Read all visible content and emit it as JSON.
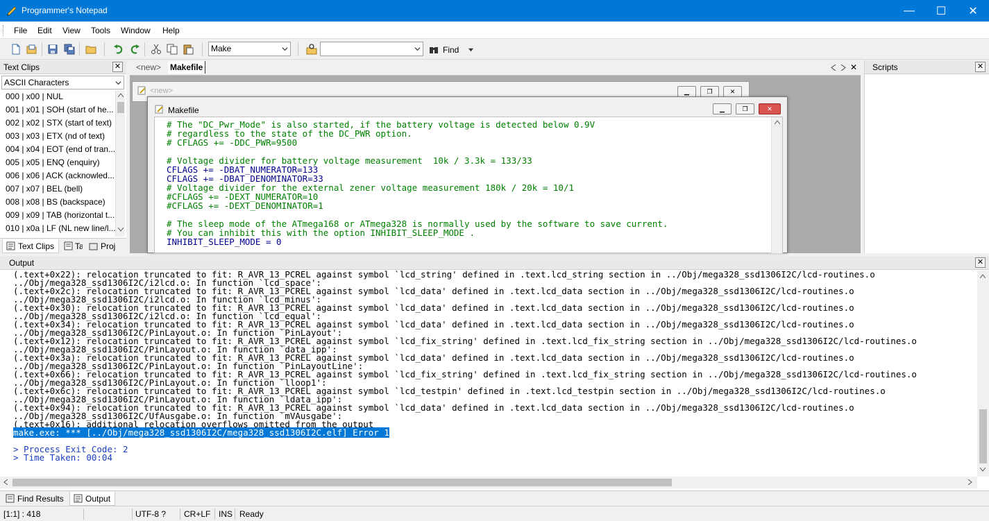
{
  "window": {
    "title": "Programmer's Notepad",
    "minimize": "—",
    "maximize": "☐",
    "close": "✕"
  },
  "menu": [
    "File",
    "Edit",
    "View",
    "Tools",
    "Window",
    "Help"
  ],
  "toolbar": {
    "scheme_value": "Make",
    "search_value": "",
    "find_label": "Find"
  },
  "clips_panel": {
    "title": "Text Clips",
    "category": "ASCII Characters",
    "items": [
      "000 | x00 | NUL",
      "001 | x01 | SOH (start of he...",
      "002 | x02 | STX (start of text)",
      "003 | x03 | ETX (nd of text)",
      "004 | x04 | EOT (end of tran...",
      "005 | x05 | ENQ (enquiry)",
      "006 | x06 | ACK (acknowled...",
      "007 | x07 | BEL (bell)",
      "008 | x08 | BS (backspace)",
      "009 | x09 | TAB (horizontal t...",
      "010 | x0a | LF (NL new line/l..."
    ],
    "tabs": [
      "Text Clips",
      "Ta",
      "Proj"
    ]
  },
  "doc_tabs": [
    "<new>",
    "Makefile"
  ],
  "child_new": {
    "title": "<new>"
  },
  "child_makefile": {
    "title": "Makefile"
  },
  "code_lines": [
    {
      "cls": "cmt",
      "text": "# The \"DC_Pwr_Mode\" is also started, if the battery voltage is detected below 0.9V"
    },
    {
      "cls": "cmt",
      "text": "# regardless to the state of the DC_PWR option."
    },
    {
      "cls": "cmt",
      "text": "# CFLAGS += -DDC_PWR=9500"
    },
    {
      "cls": "",
      "text": ""
    },
    {
      "cls": "cmt",
      "text": "# Voltage divider for battery voltage measurement  10k / 3.3k = 133/33"
    },
    {
      "cls": "kw",
      "text": "CFLAGS += -DBAT_NUMERATOR=133"
    },
    {
      "cls": "kw",
      "text": "CFLAGS += -DBAT_DENOMINATOR=33"
    },
    {
      "cls": "cmt",
      "text": "# Voltage divider for the external zener voltage measurement 180k / 20k = 10/1"
    },
    {
      "cls": "cmt",
      "text": "#CFLAGS += -DEXT_NUMERATOR=10"
    },
    {
      "cls": "cmt",
      "text": "#CFLAGS += -DEXT_DENOMINATOR=1"
    },
    {
      "cls": "",
      "text": ""
    },
    {
      "cls": "cmt",
      "text": "# The sleep mode of the ATmega168 or ATmega328 is normally used by the software to save current."
    },
    {
      "cls": "cmt",
      "text": "# You can inhibit this with the option INHIBIT_SLEEP_MODE ."
    },
    {
      "cls": "kw",
      "text": "INHIBIT_SLEEP_MODE = 0"
    }
  ],
  "scripts_panel": {
    "title": "Scripts"
  },
  "output_panel": {
    "title": "Output",
    "lines": [
      {
        "cls": "",
        "text": "(.text+0x22): relocation truncated to fit: R_AVR_13_PCREL against symbol `lcd_string' defined in .text.lcd_string section in ../Obj/mega328_ssd1306I2C/lcd-routines.o"
      },
      {
        "cls": "",
        "text": "../Obj/mega328_ssd1306I2C/i2lcd.o: In function `lcd_space':"
      },
      {
        "cls": "",
        "text": "(.text+0x2c): relocation truncated to fit: R_AVR_13_PCREL against symbol `lcd_data' defined in .text.lcd_data section in ../Obj/mega328_ssd1306I2C/lcd-routines.o"
      },
      {
        "cls": "",
        "text": "../Obj/mega328_ssd1306I2C/i2lcd.o: In function `lcd_minus':"
      },
      {
        "cls": "",
        "text": "(.text+0x30): relocation truncated to fit: R_AVR_13_PCREL against symbol `lcd_data' defined in .text.lcd_data section in ../Obj/mega328_ssd1306I2C/lcd-routines.o"
      },
      {
        "cls": "",
        "text": "../Obj/mega328_ssd1306I2C/i2lcd.o: In function `lcd_equal':"
      },
      {
        "cls": "",
        "text": "(.text+0x34): relocation truncated to fit: R_AVR_13_PCREL against symbol `lcd_data' defined in .text.lcd_data section in ../Obj/mega328_ssd1306I2C/lcd-routines.o"
      },
      {
        "cls": "",
        "text": "../Obj/mega328_ssd1306I2C/PinLayout.o: In function `PinLayout':"
      },
      {
        "cls": "",
        "text": "(.text+0x12): relocation truncated to fit: R_AVR_13_PCREL against symbol `lcd_fix_string' defined in .text.lcd_fix_string section in ../Obj/mega328_ssd1306I2C/lcd-routines.o"
      },
      {
        "cls": "",
        "text": "../Obj/mega328_ssd1306I2C/PinLayout.o: In function `data_ipp':"
      },
      {
        "cls": "",
        "text": "(.text+0x3a): relocation truncated to fit: R_AVR_13_PCREL against symbol `lcd_data' defined in .text.lcd_data section in ../Obj/mega328_ssd1306I2C/lcd-routines.o"
      },
      {
        "cls": "",
        "text": "../Obj/mega328_ssd1306I2C/PinLayout.o: In function `PinLayoutLine':"
      },
      {
        "cls": "",
        "text": "(.text+0x66): relocation truncated to fit: R_AVR_13_PCREL against symbol `lcd_fix_string' defined in .text.lcd_fix_string section in ../Obj/mega328_ssd1306I2C/lcd-routines.o"
      },
      {
        "cls": "",
        "text": "../Obj/mega328_ssd1306I2C/PinLayout.o: In function `lloop1':"
      },
      {
        "cls": "",
        "text": "(.text+0x6c): relocation truncated to fit: R_AVR_13_PCREL against symbol `lcd_testpin' defined in .text.lcd_testpin section in ../Obj/mega328_ssd1306I2C/lcd-routines.o"
      },
      {
        "cls": "",
        "text": "../Obj/mega328_ssd1306I2C/PinLayout.o: In function `ldata_ipp':"
      },
      {
        "cls": "",
        "text": "(.text+0x94): relocation truncated to fit: R_AVR_13_PCREL against symbol `lcd_data' defined in .text.lcd_data section in ../Obj/mega328_ssd1306I2C/lcd-routines.o"
      },
      {
        "cls": "",
        "text": "../Obj/mega328_ssd1306I2C/UfAusgabe.o: In function `mVAusgabe':"
      },
      {
        "cls": "",
        "text": "(.text+0x16): additional relocation overflows omitted from the output"
      },
      {
        "cls": "sel",
        "text": "make.exe: *** [../Obj/mega328_ssd1306I2C/mega328_ssd1306I2C.elf] Error 1"
      },
      {
        "cls": "",
        "text": ""
      },
      {
        "cls": "blue",
        "text": "> Process Exit Code: 2"
      },
      {
        "cls": "blue",
        "text": "> Time Taken: 00:04"
      }
    ]
  },
  "bottom_tabs": [
    "Find Results",
    "Output"
  ],
  "status": {
    "position": "[1:1] : 418",
    "encoding": "UTF-8 ?",
    "eol": "CR+LF",
    "mode": "INS",
    "state": "Ready"
  }
}
